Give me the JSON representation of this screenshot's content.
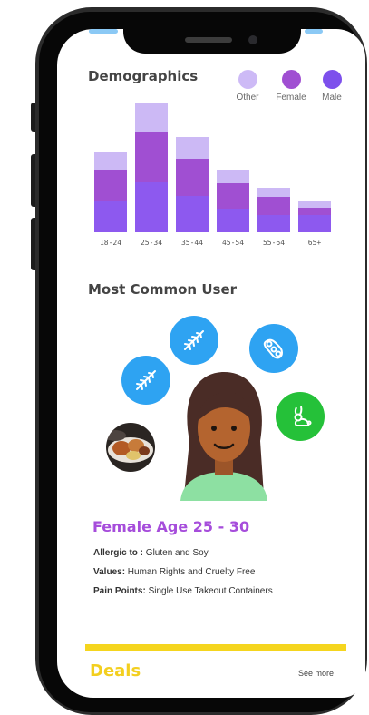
{
  "demographics": {
    "title": "Demographics",
    "legend": [
      {
        "label": "Other",
        "color": "#cdbaf6"
      },
      {
        "label": "Female",
        "color": "#a04fd2"
      },
      {
        "label": "Male",
        "color": "#7d50ec"
      }
    ]
  },
  "chart_data": {
    "type": "bar",
    "stacked": true,
    "categories": [
      "18-24",
      "25-34",
      "35-44",
      "45-54",
      "55-64",
      "65+"
    ],
    "series": [
      {
        "name": "Male",
        "color": "#8d59ef",
        "values": [
          35,
          57,
          41,
          27,
          20,
          20
        ]
      },
      {
        "name": "Female",
        "color": "#a04fd2",
        "values": [
          36,
          57,
          42,
          28,
          20,
          8
        ]
      },
      {
        "name": "Other",
        "color": "#ccb9f5",
        "values": [
          20,
          33,
          25,
          16,
          10,
          7
        ]
      }
    ],
    "ylim": [
      0,
      150
    ],
    "grid": false,
    "legend_position": "top-right"
  },
  "user": {
    "title": "Most Common User",
    "name": "Female   Age 25 - 30",
    "allergic_label": "Allergic to :",
    "allergic_value": " Gluten and Soy",
    "values_label": "Values:",
    "values_value": " Human Rights and Cruelty Free",
    "pain_label": "Pain Points:",
    "pain_value": " Single Use Takeout Containers",
    "icons": [
      "wheat-icon",
      "wheat-icon",
      "soybean-icon",
      "cruelty-free-bunny-icon",
      "food-photo"
    ]
  },
  "deals": {
    "title": "Deals",
    "see_more": "See more",
    "accent": "#f5d51e"
  }
}
